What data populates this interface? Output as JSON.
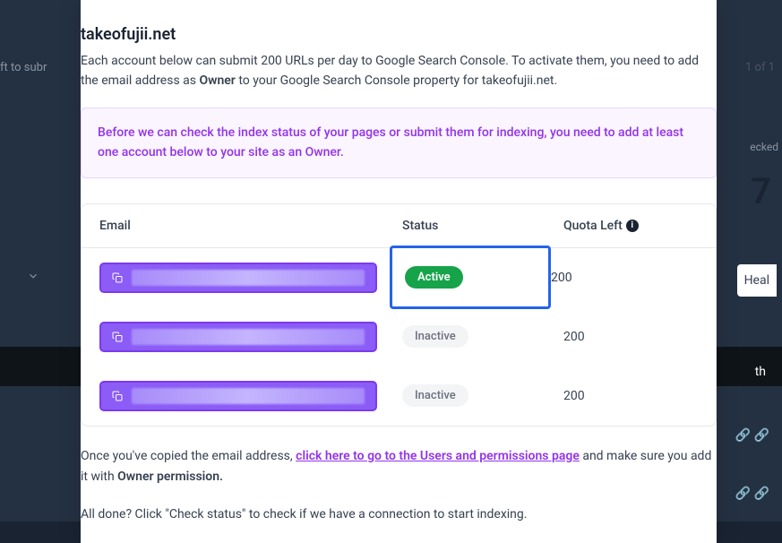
{
  "background": {
    "left_text": "ft to subr",
    "right_text": "1 of 1",
    "checked_label": "ecked",
    "big_number": "7",
    "heal_text": "Heal",
    "th_text": "th"
  },
  "modal": {
    "domain": "takeofujii.net",
    "intro_part1": "Each account below can submit 200 URLs per day to Google Search Console. To activate them, you need to add the email address as ",
    "intro_strong1": "Owner",
    "intro_part2": " to your Google Search Console property for takeofujii.net.",
    "warning": "Before we can check the index status of your pages or submit them for indexing, you need to add at least one account below to your site as an Owner.",
    "headers": {
      "email": "Email",
      "status": "Status",
      "quota": "Quota Left"
    },
    "rows": [
      {
        "status": "Active",
        "quota": "200",
        "highlighted": true
      },
      {
        "status": "Inactive",
        "quota": "200",
        "highlighted": false
      },
      {
        "status": "Inactive",
        "quota": "200",
        "highlighted": false
      }
    ],
    "footer_part1": "Once you've copied the email address, ",
    "footer_link": "click here to go to the Users and permissions page",
    "footer_part2": " and make sure you add it with ",
    "footer_strong": "Owner permission.",
    "footer2": "All done? Click \"Check status\" to check if we have a connection to start indexing."
  }
}
